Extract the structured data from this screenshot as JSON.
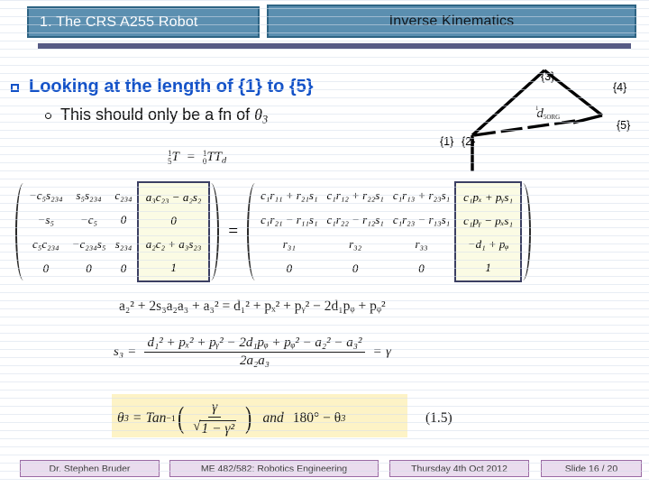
{
  "header": {
    "section_title": "1. The CRS A255 Robot",
    "topic_title": "Inverse Kinematics"
  },
  "bullets": {
    "primary": {
      "text_before": "Looking at the length of {1} to {5}",
      "marker": "square-bullet"
    },
    "secondary": {
      "text_before": "This should only be a fn of ",
      "symbol": "θ",
      "symbol_sub": "3",
      "marker": "circle-bullet"
    }
  },
  "diagram": {
    "name": "robot-link-diagram",
    "frame_labels": [
      "{1}",
      "{2}",
      "{3}",
      "{4}",
      "{5}"
    ],
    "vector_label_prefix": "1",
    "vector_label_symbol": "d",
    "vector_label_sub": "5ORG"
  },
  "transform_equation": {
    "left_pre_sub": "5",
    "left_pre_sup": "1",
    "left_symbol": "T",
    "equals": "=",
    "right_pre_sub": "0",
    "right_pre_sup": "1",
    "right_symbol": "T",
    "right_symbol_2": "T",
    "right_symbol_2_sub": "d"
  },
  "matrix_left": {
    "columns": [
      [
        "−c₅s₂₃₄",
        "−s₅",
        "c₅c₂₃₄",
        "0"
      ],
      [
        "s₅s₂₃₄",
        "−c₅",
        "−c₂₃₄s₅",
        "0"
      ],
      [
        "c₂₃₄",
        "0",
        "s₂₃₄",
        "0"
      ],
      [
        "a₃c₂₃ − a₂s₂",
        "0",
        "a₂c₂ + a₃s₂₃",
        "1"
      ]
    ],
    "highlight_column_index": 3
  },
  "matrix_equals_sign": "=",
  "matrix_right": {
    "columns": [
      [
        "c₁r₁₁ + r₂₁s₁",
        "c₁r₂₁ − r₁₁s₁",
        "r₃₁",
        "0"
      ],
      [
        "c₁r₁₂ + r₂₂s₁",
        "c₁r₂₂ − r₁₂s₁",
        "r₃₂",
        "0"
      ],
      [
        "c₁r₁₃ + r₂₃s₁",
        "c₁r₂₃ − r₁₃s₁",
        "r₃₃",
        "0"
      ],
      [
        "c₁pₓ + pᵧs₁",
        "c₁pᵧ − pₓs₁",
        "−d₁ + pᵩ",
        "1"
      ]
    ],
    "highlight_column_index": 3
  },
  "equation_1": "a₂² + 2s₃a₂a₃ + a₃² = d₁² + pₓ² + pᵧ² − 2d₁pᵩ + pᵩ²",
  "equation_2": {
    "lhs": "s₃",
    "equals": "=",
    "numerator": "d₁² + pₓ² + pᵧ² − 2d₁pᵩ + pᵩ² − a₂² − a₃²",
    "denominator": "2a₂a₃",
    "equals_2": "=",
    "rhs": "γ"
  },
  "equation_final": {
    "lhs_symbol": "θ",
    "lhs_sub": "3",
    "equals": "=",
    "function": "Tan",
    "function_exp": "−1",
    "numerator": "γ",
    "denominator_radicand": "1 − γ²",
    "conjunction": "and",
    "second_solution": "180° − θ",
    "second_solution_sub": "3",
    "number": "(1.5)"
  },
  "footer": {
    "author": "Dr. Stephen Bruder",
    "course": "ME 482/582: Robotics Engineering",
    "date": "Thursday 4th Oct 2012",
    "slide": "Slide 16 /  20"
  },
  "colors": {
    "title_box_bg": "#5b8fb0",
    "title_box_border": "#2e6484",
    "accent_bar": "#565b85",
    "bullet_blue": "#1352c8",
    "highlight_cream": "#fbfbe4",
    "highlight_border": "#3b3f63",
    "equation_highlight": "#fdf3c6",
    "footer_bg": "#eadcee",
    "footer_border": "#9a6ba4"
  }
}
